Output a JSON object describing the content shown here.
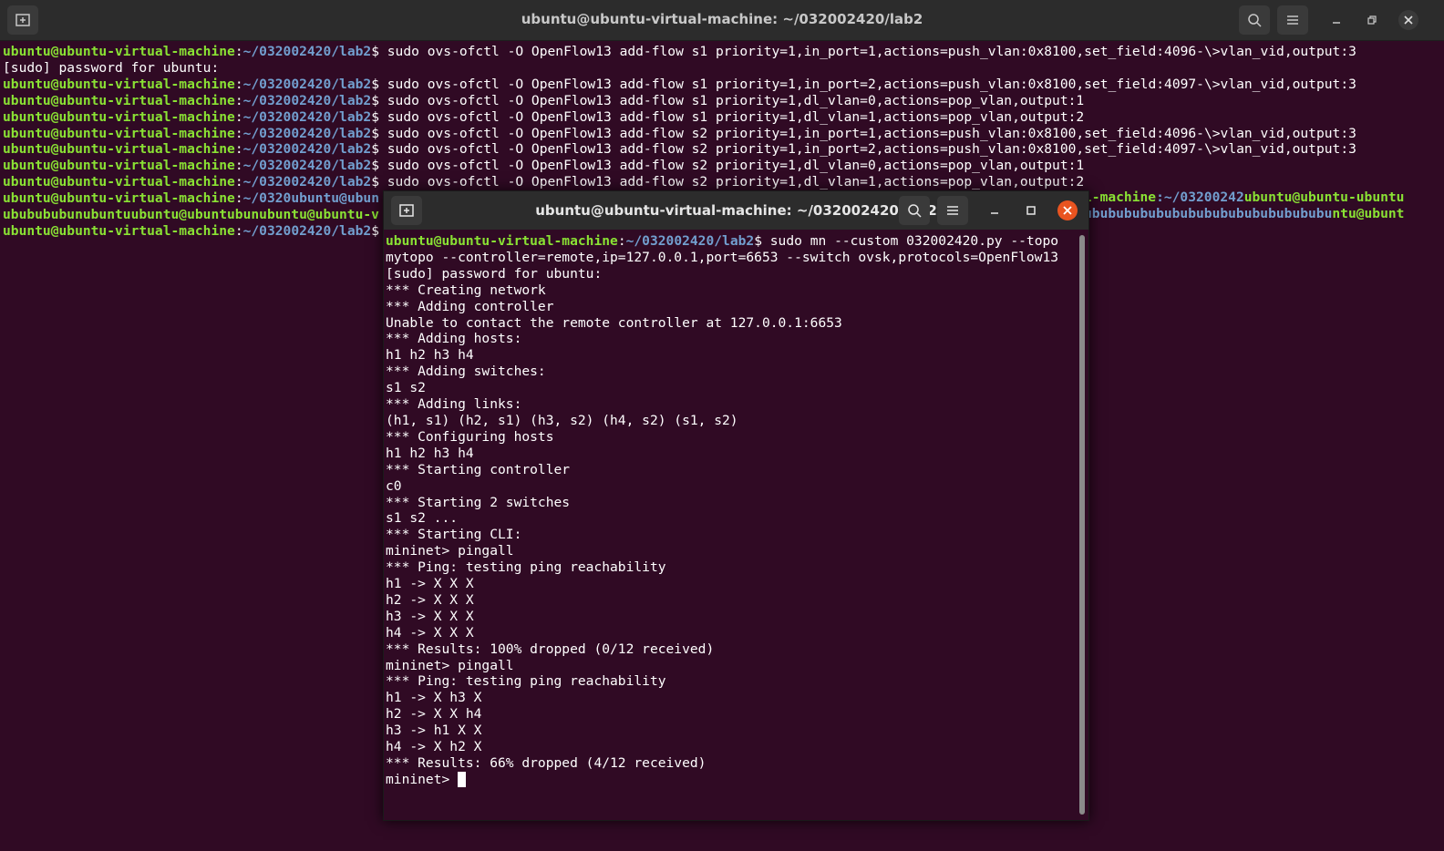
{
  "back_window": {
    "title": "ubuntu@ubuntu-virtual-machine: ~/032002420/lab2",
    "lines": [
      {
        "u": "ubuntu@ubuntu-virtual-machine",
        "p": "~/032002420/lab2",
        "c": "$ sudo ovs-ofctl -O OpenFlow13 add-flow s1 priority=1,in_port=1,actions=push_vlan:0x8100,set_field:4096-\\>vlan_vid,output:3"
      },
      {
        "u": "",
        "p": "",
        "c": "[sudo] password for ubuntu:"
      },
      {
        "u": "ubuntu@ubuntu-virtual-machine",
        "p": "~/032002420/lab2",
        "c": "$ sudo ovs-ofctl -O OpenFlow13 add-flow s1 priority=1,in_port=2,actions=push_vlan:0x8100,set_field:4097-\\>vlan_vid,output:3"
      },
      {
        "u": "ubuntu@ubuntu-virtual-machine",
        "p": "~/032002420/lab2",
        "c": "$ sudo ovs-ofctl -O OpenFlow13 add-flow s1 priority=1,dl_vlan=0,actions=pop_vlan,output:1"
      },
      {
        "u": "ubuntu@ubuntu-virtual-machine",
        "p": "~/032002420/lab2",
        "c": "$ sudo ovs-ofctl -O OpenFlow13 add-flow s1 priority=1,dl_vlan=1,actions=pop_vlan,output:2"
      },
      {
        "u": "ubuntu@ubuntu-virtual-machine",
        "p": "~/032002420/lab2",
        "c": "$ sudo ovs-ofctl -O OpenFlow13 add-flow s2 priority=1,in_port=1,actions=push_vlan:0x8100,set_field:4096-\\>vlan_vid,output:3"
      },
      {
        "u": "ubuntu@ubuntu-virtual-machine",
        "p": "~/032002420/lab2",
        "c": "$ sudo ovs-ofctl -O OpenFlow13 add-flow s2 priority=1,in_port=2,actions=push_vlan:0x8100,set_field:4097-\\>vlan_vid,output:3"
      },
      {
        "u": "ubuntu@ubuntu-virtual-machine",
        "p": "~/032002420/lab2",
        "c": "$ sudo ovs-ofctl -O OpenFlow13 add-flow s2 priority=1,dl_vlan=0,actions=pop_vlan,output:1"
      },
      {
        "u": "ubuntu@ubuntu-virtual-machine",
        "p": "~/032002420/lab2",
        "c": "$ sudo ovs-ofctl -O OpenFlow13 add-flow s2 priority=1,dl_vlan=1,actions=pop_vlan,output:2"
      },
      {
        "u": "ubuntu@ubuntu-virtual-machine",
        "p": "~/0320ubuntu@ubun",
        "c": ""
      },
      {
        "u": "ububububunubuntuubuntu@ubuntubunubuntu@ubuntu-v",
        "p": "",
        "c": ""
      },
      {
        "u": "ubuntu@ubuntu-virtual-machine",
        "p": "~/032002420/lab2",
        "c": "$"
      }
    ],
    "right_fragments": [
      {
        "u": "l-machine",
        "p": ":~/03200242",
        "u2": "ubuntu@ubuntu-ubuntu"
      },
      {
        "u": "",
        "p": "ubububububububububububububububu",
        "u2": "ntu@ubunt"
      }
    ]
  },
  "front_window": {
    "title": "ubuntu@ubuntu-virtual-machine: ~/032002420/lab2",
    "prompt_user": "ubuntu@ubuntu-virtual-machine",
    "prompt_path": "~/032002420/lab2",
    "prompt_cmd": "$ sudo mn --custom 032002420.py --topo",
    "lines": [
      "mytopo --controller=remote,ip=127.0.0.1,port=6653 --switch ovsk,protocols=OpenFlow13",
      "[sudo] password for ubuntu:",
      "*** Creating network",
      "*** Adding controller",
      "Unable to contact the remote controller at 127.0.0.1:6653",
      "*** Adding hosts:",
      "h1 h2 h3 h4",
      "*** Adding switches:",
      "s1 s2",
      "*** Adding links:",
      "(h1, s1) (h2, s1) (h3, s2) (h4, s2) (s1, s2)",
      "*** Configuring hosts",
      "h1 h2 h3 h4",
      "*** Starting controller",
      "c0",
      "*** Starting 2 switches",
      "s1 s2 ...",
      "*** Starting CLI:",
      "mininet> pingall",
      "*** Ping: testing ping reachability",
      "h1 -> X X X",
      "h2 -> X X X",
      "h3 -> X X X",
      "h4 -> X X X",
      "*** Results: 100% dropped (0/12 received)",
      "mininet> pingall",
      "*** Ping: testing ping reachability",
      "h1 -> X h3 X",
      "h2 -> X X h4",
      "h3 -> h1 X X",
      "h4 -> X h2 X",
      "*** Results: 66% dropped (4/12 received)"
    ],
    "final_prompt": "mininet> "
  }
}
